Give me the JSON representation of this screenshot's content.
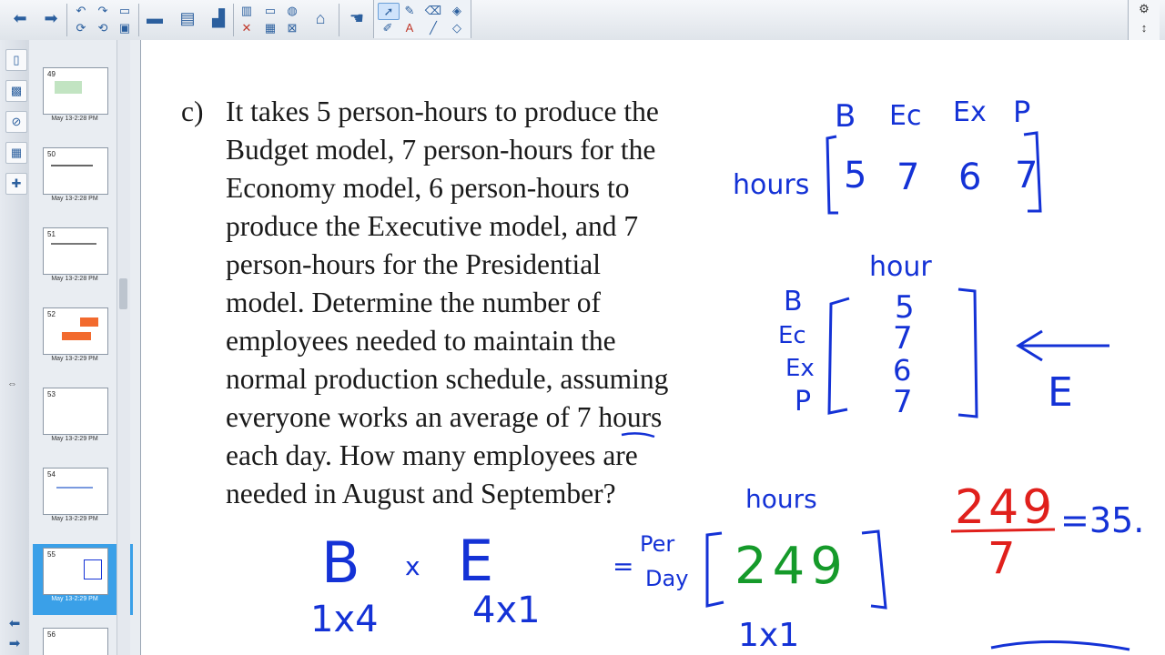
{
  "toolbar": {
    "buttons": [
      {
        "name": "back-button",
        "icon": "arrow-left-icon",
        "glyph": "⬅"
      },
      {
        "name": "forward-button",
        "icon": "arrow-right-icon",
        "glyph": "➡"
      },
      {
        "name": "undo-button",
        "icon": "undo-icon",
        "glyph": "↶"
      },
      {
        "name": "redo-button",
        "icon": "redo-icon",
        "glyph": "↷"
      },
      {
        "name": "save-button",
        "icon": "save-icon",
        "glyph": "💾"
      }
    ],
    "right_controls": [
      "⚙",
      "↕"
    ]
  },
  "pages": [
    {
      "num": "49",
      "cap": "May 13-2:28 PM"
    },
    {
      "num": "50",
      "cap": "May 13-2:28 PM"
    },
    {
      "num": "51",
      "cap": "May 13-2:28 PM"
    },
    {
      "num": "52",
      "cap": "May 13-2:29 PM"
    },
    {
      "num": "53",
      "cap": "May 13-2:29 PM"
    },
    {
      "num": "54",
      "cap": "May 13-2:29 PM"
    },
    {
      "num": "55",
      "cap": "May 13-2:29 PM"
    },
    {
      "num": "56",
      "cap": ""
    }
  ],
  "problem": {
    "label": "c)",
    "lines": [
      "It takes 5 person-hours to produce the",
      "Budget model, 7 person-hours for the",
      "Economy model, 6 person-hours to",
      "produce the Executive model, and 7",
      "person-hours for the Presidential",
      "model. Determine the number of",
      "employees needed to maintain the",
      "normal production schedule, assuming",
      "everyone works an average of 7 hours",
      "each day. How many employees are",
      "needed in August and September?"
    ]
  },
  "ink": {
    "row_headers": [
      "B",
      "Ec",
      "Ex",
      "P"
    ],
    "row_label": "hours",
    "row_values": [
      "5",
      "7",
      "6",
      "7"
    ],
    "col_header": "hour",
    "col_labels": [
      "B",
      "Ec",
      "Ex",
      "P"
    ],
    "col_values": [
      "5",
      "7",
      "6",
      "7"
    ],
    "col_name": "E",
    "eq_left": "B",
    "eq_times": "x",
    "eq_right": "E",
    "dim_left": "1x4",
    "dim_right": "4x1",
    "per_day_1": "Per",
    "per_day_2": "Day",
    "result_label": "hours",
    "result_value": "249",
    "result_dim": "1x1",
    "frac_num": "249",
    "frac_den": "7",
    "frac_result": "=35."
  }
}
